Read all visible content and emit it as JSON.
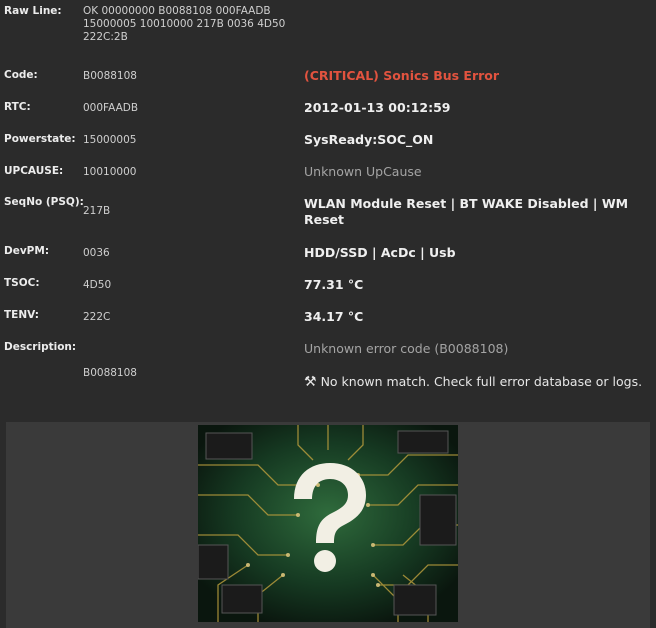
{
  "raw_line": {
    "label": "Raw Line:",
    "lines": [
      "OK 00000000 B0088108 000FAADB",
      "15000005 10010000 217B 0036 4D50",
      "222C:2B"
    ]
  },
  "fields": [
    {
      "label": "Code:",
      "value": "B0088108",
      "decoded": "(CRITICAL) Sonics Bus Error"
    },
    {
      "label": "RTC:",
      "value": "000FAADB",
      "decoded": "2012-01-13 00:12:59"
    },
    {
      "label": "Powerstate:",
      "value": "15000005",
      "decoded": "SysReady:SOC_ON"
    },
    {
      "label": "UPCAUSE:",
      "value": "10010000",
      "decoded": "Unknown UpCause"
    },
    {
      "label": "SeqNo (PSQ):",
      "value": "217B",
      "decoded": "WLAN Module Reset | BT WAKE Disabled | WM Reset"
    },
    {
      "label": "DevPM:",
      "value": "0036",
      "decoded": "HDD/SSD | AcDc | Usb"
    },
    {
      "label": "TSOC:",
      "value": "4D50",
      "decoded": "77.31 °C"
    },
    {
      "label": "TENV:",
      "value": "222C",
      "decoded": "34.17 °C"
    }
  ],
  "description": {
    "label": "Description:",
    "decoded": "Unknown error code (B0088108)",
    "code": "B0088108",
    "note": "No known match. Check full error database or logs.",
    "note_icon": "tools-icon"
  },
  "image": {
    "icon": "circuit-board-question-mark-image"
  },
  "colors": {
    "background": "#2b2b2b",
    "critical": "#e2533f",
    "muted": "#a4a4a4",
    "panel": "#3a3a3a"
  }
}
